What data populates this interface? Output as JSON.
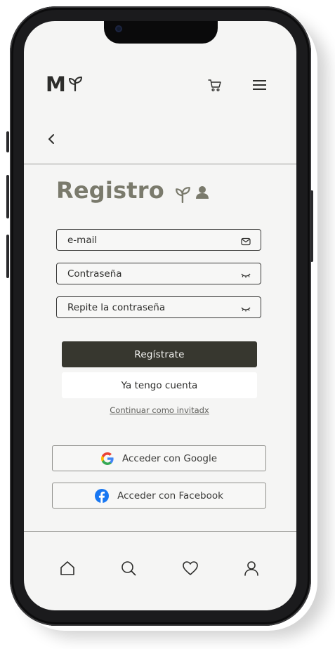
{
  "header": {
    "logo_text": "M",
    "logo_icon": "sprout-icon",
    "cart_icon": "cart-icon",
    "menu_icon": "hamburger-icon"
  },
  "nav": {
    "back_icon": "chevron-left-icon"
  },
  "page": {
    "title": "Registro",
    "title_icons": [
      "sprout-icon",
      "user-icon"
    ]
  },
  "form": {
    "email_placeholder": "e-mail",
    "email_icon": "envelope-icon",
    "password_placeholder": "Contraseña",
    "password_icon": "eye-closed-icon",
    "repeat_password_placeholder": "Repite la contraseña",
    "repeat_password_icon": "eye-closed-icon",
    "register_label": "Regístrate",
    "have_account_label": "Ya tengo cuenta",
    "guest_label": "Continuar como invitadx"
  },
  "social": {
    "google_label": "Acceder con Google",
    "google_icon": "google-icon",
    "facebook_label": "Acceder con Facebook",
    "facebook_icon": "facebook-icon"
  },
  "bottom_nav": {
    "items": [
      "home-icon",
      "search-icon",
      "heart-icon",
      "user-icon"
    ]
  },
  "colors": {
    "background": "#f5f5f4",
    "title": "#7a7a6c",
    "primary_button": "#37372f",
    "text": "#2e2e2c"
  }
}
